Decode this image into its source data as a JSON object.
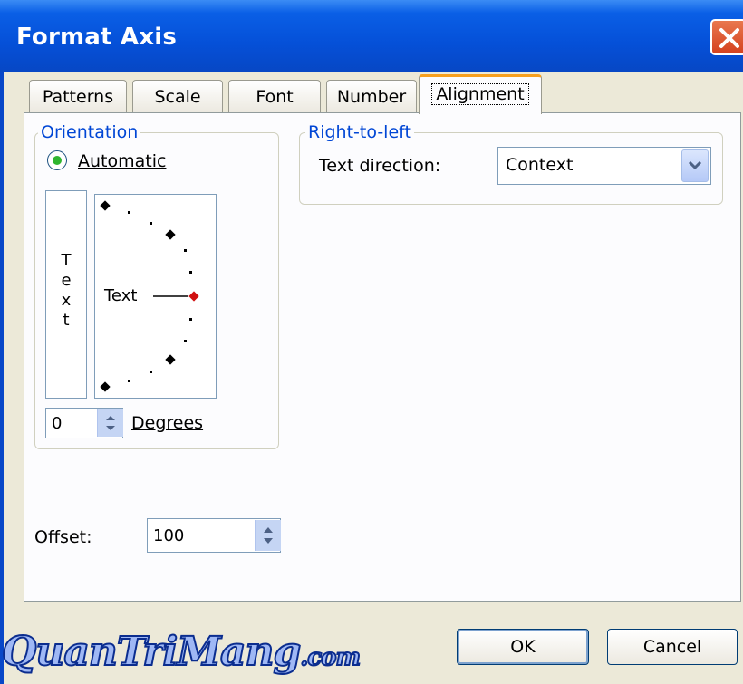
{
  "window": {
    "title": "Format Axis"
  },
  "tabs": [
    {
      "label": "Patterns",
      "active": false
    },
    {
      "label": "Scale",
      "active": false
    },
    {
      "label": "Font",
      "active": false
    },
    {
      "label": "Number",
      "active": false
    },
    {
      "label": "Alignment",
      "active": true
    }
  ],
  "orientation": {
    "group_label": "Orientation",
    "automatic_label": "Automatic",
    "automatic_selected": true,
    "vertical_text": [
      "T",
      "e",
      "x",
      "t"
    ],
    "dial_text": "Text",
    "degrees_value": "0",
    "degrees_label": "Degrees"
  },
  "right_to_left": {
    "group_label": "Right-to-left",
    "text_direction_label": "Text direction:",
    "text_direction_value": "Context"
  },
  "offset": {
    "label": "Offset:",
    "value": "100"
  },
  "buttons": {
    "ok": "OK",
    "cancel": "Cancel"
  },
  "watermark": {
    "main": "QuanTriMang",
    "suffix": ".com"
  },
  "colors": {
    "titlebar": "#0550d8",
    "accent_tab": "#f7a01f",
    "group_label": "#0046d5",
    "radio_dot": "#2fb52f",
    "dial_marker": "#d01010"
  }
}
